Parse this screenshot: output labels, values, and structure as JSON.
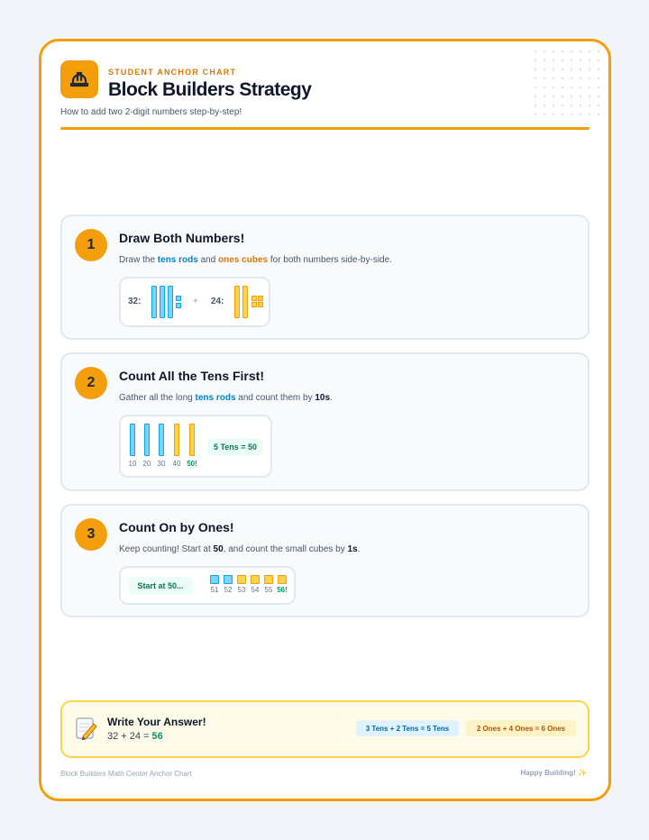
{
  "header": {
    "kicker": "STUDENT ANCHOR CHART",
    "title": "Block Builders Strategy",
    "subtitle": "How to add two 2-digit numbers step-by-step!",
    "logo_icon": "hard-hat-icon"
  },
  "steps": [
    {
      "number": "1",
      "title": "Draw Both Numbers!",
      "desc_a": "Draw the ",
      "desc_tens": "tens rods",
      "desc_b": " and ",
      "desc_ones": "ones cubes",
      "desc_c": " for both numbers side-by-side.",
      "first_label": "32:",
      "plus": "+",
      "second_label": "24:"
    },
    {
      "number": "2",
      "title": "Count All the Tens First!",
      "desc_a": "Gather all the long ",
      "desc_tens": "tens rods",
      "desc_b": " and count them by ",
      "desc_strong": "10s",
      "desc_c": ".",
      "ticks": [
        "10",
        "20",
        "30",
        "40",
        "50!"
      ],
      "result": "5 Tens = 50"
    },
    {
      "number": "3",
      "title": "Count On by Ones!",
      "desc_a": "Keep counting! Start at ",
      "desc_strong1": "50",
      "desc_b": ", and count the small cubes by ",
      "desc_strong2": "1s",
      "desc_c": ".",
      "start": "Start at 50...",
      "ticks": [
        "51",
        "52",
        "53",
        "54",
        "55",
        "56!"
      ]
    }
  ],
  "answer": {
    "icon": "memo-pencil-icon",
    "title": "Write Your Answer!",
    "equation": "32 + 24 = ",
    "result": "56",
    "tens_chip": "3 Tens + 2 Tens = 5 Tens",
    "ones_chip": "2 Ones + 4 Ones = 6 Ones"
  },
  "footer": {
    "left": "Block Builders Math Center Anchor Chart",
    "right": "Happy Building!",
    "right_icon": "sparkle-icon"
  },
  "colors": {
    "accent": "#f59e0b",
    "tens": "#0284c7",
    "ones": "#d97706",
    "success": "#059669"
  }
}
